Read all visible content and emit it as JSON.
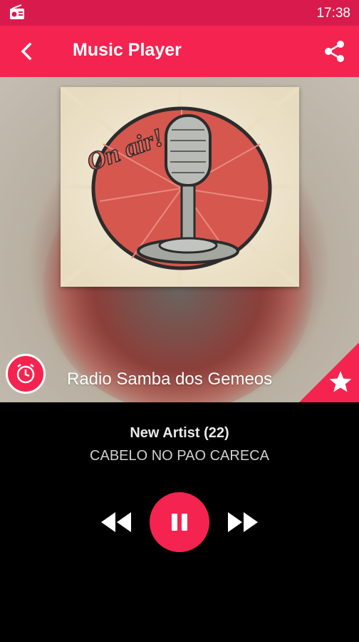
{
  "status_bar": {
    "time": "17:38",
    "icon": "radio-icon"
  },
  "toolbar": {
    "title": "Music Player",
    "back_icon": "back-arrow-icon",
    "share_icon": "share-icon"
  },
  "station": {
    "name": "Radio Samba dos Gemeos",
    "cover_text": "On air!",
    "alarm_icon": "alarm-clock-icon",
    "favorite_icon": "star-icon"
  },
  "now_playing": {
    "artist": "New Artist (22)",
    "song": "CABELO NO PAO CARECA"
  },
  "controls": {
    "rewind_icon": "rewind-icon",
    "pause_icon": "pause-icon",
    "forward_icon": "fast-forward-icon"
  },
  "colors": {
    "accent": "#f5234f",
    "statusbar": "#d81b4c",
    "background": "#000000"
  }
}
